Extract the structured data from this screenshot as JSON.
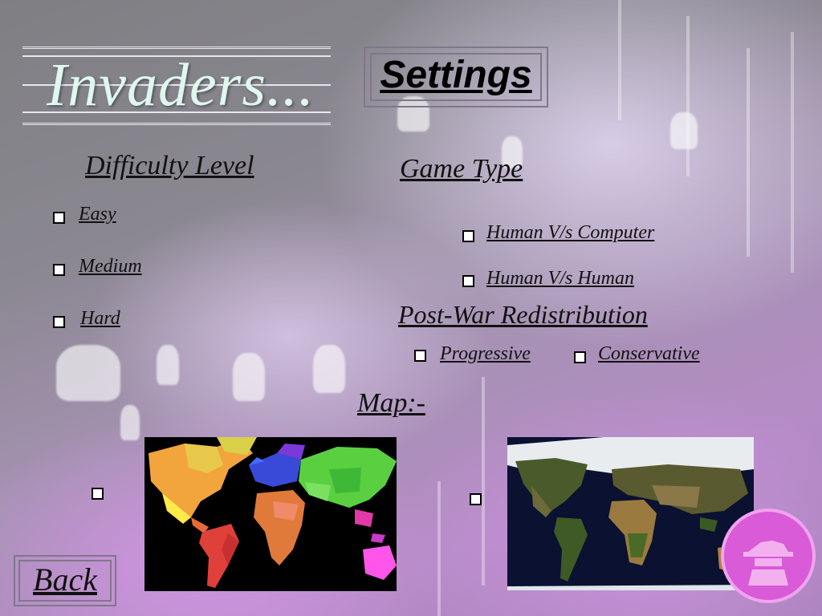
{
  "app": {
    "logo_text": "Invaders...",
    "title": "Settings"
  },
  "difficulty": {
    "heading": "Difficulty  Level",
    "options": [
      "Easy",
      "Medium",
      "Hard"
    ]
  },
  "game_type": {
    "heading": "Game  Type",
    "options": [
      "Human  V/s  Computer",
      "Human  V/s  Human"
    ]
  },
  "redistribution": {
    "heading": "Post-War Redistribution",
    "options": [
      "Progressive",
      "Conservative"
    ]
  },
  "map": {
    "heading": "Map:-",
    "options": [
      "political-map",
      "satellite-map"
    ]
  },
  "navigation": {
    "back_label": "Back"
  },
  "colors": {
    "logo_text": "#dff7ee",
    "frame": "#80778a",
    "checkbox_fill": "#ffffff",
    "checkbox_border": "#000000",
    "emblem": "#d95bd7"
  }
}
